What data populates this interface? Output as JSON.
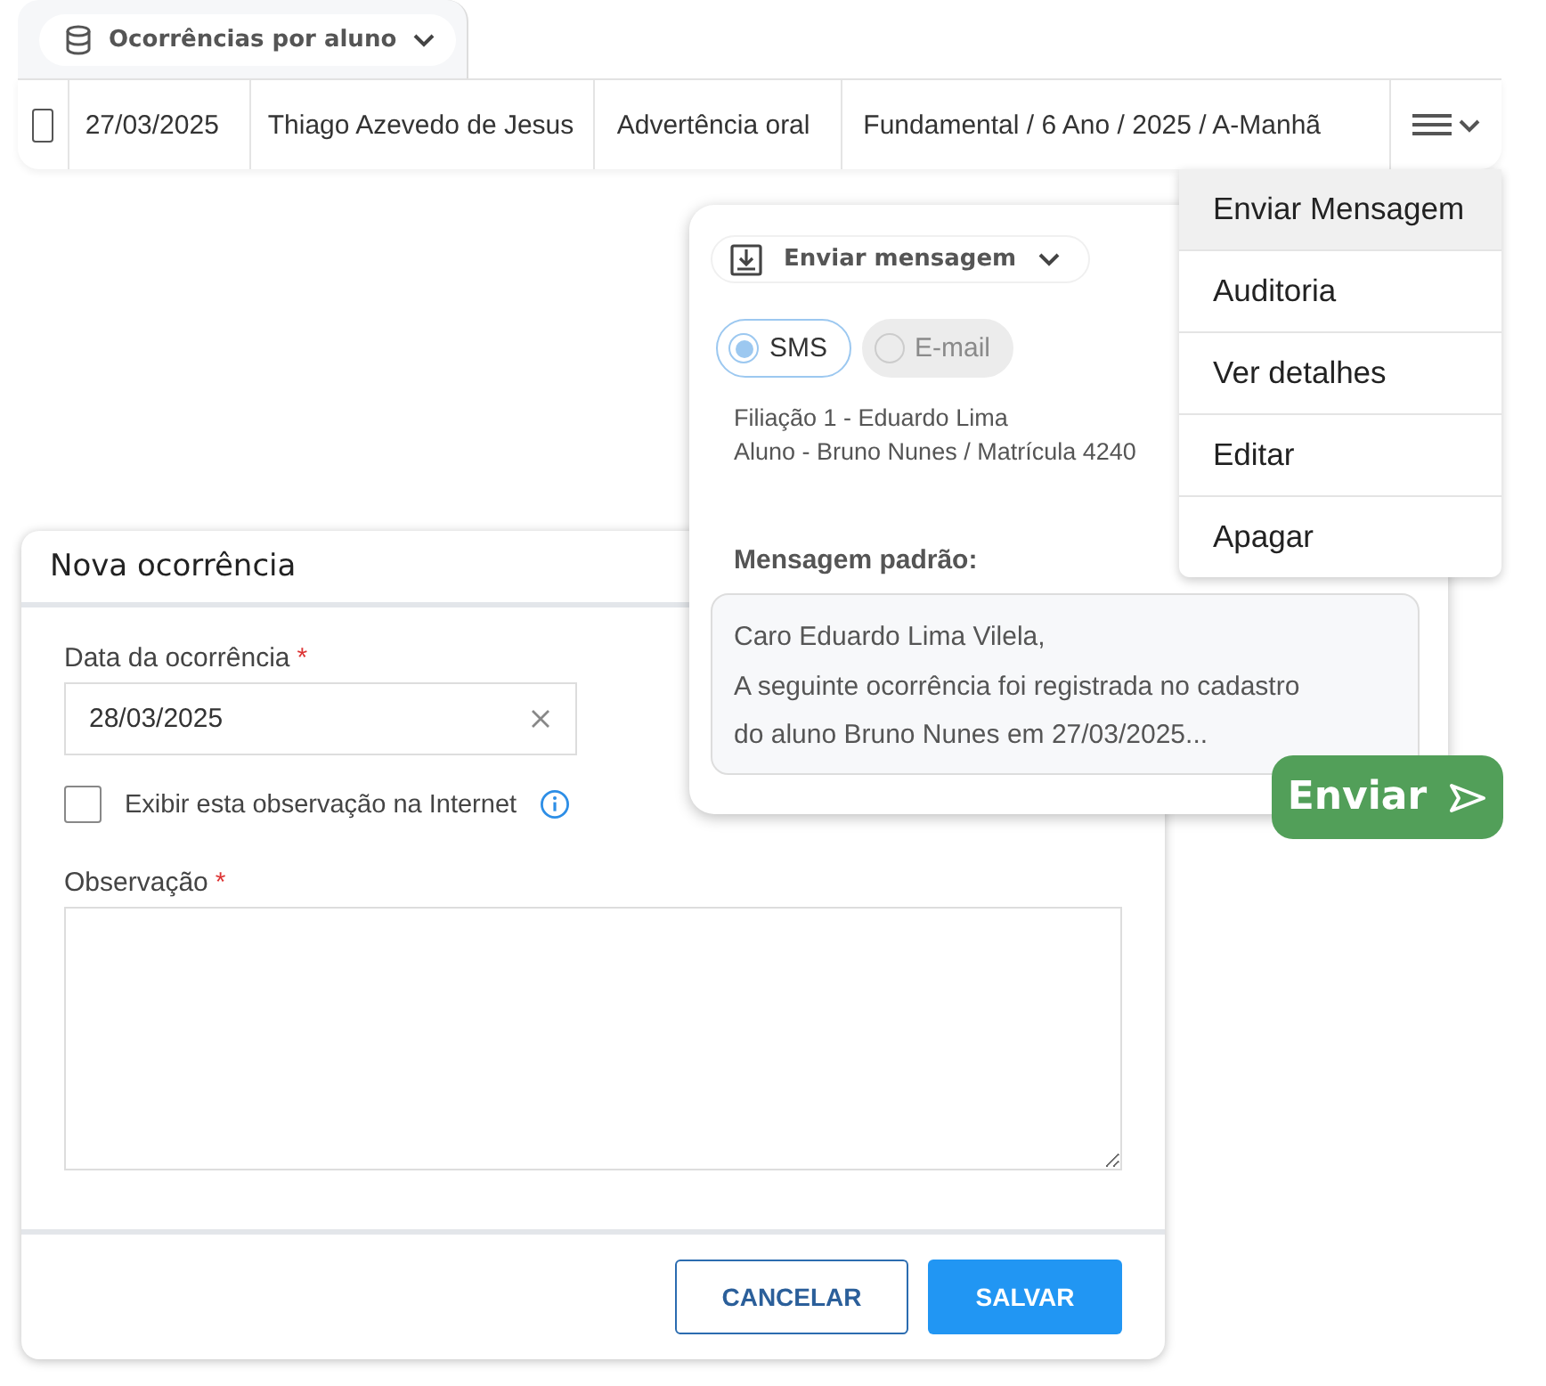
{
  "tab": {
    "label": "Ocorrências por aluno"
  },
  "row": {
    "checked": false,
    "cells": [
      "27/03/2025",
      "Thiago Azevedo de Jesus",
      "Advertência oral",
      "Fundamental / 6 Ano / 2025 / A-Manhã"
    ]
  },
  "menu": {
    "items": [
      {
        "label": "Enviar Mensagem",
        "selected": true
      },
      {
        "label": "Auditoria",
        "selected": false
      },
      {
        "label": "Ver detalhes",
        "selected": false
      },
      {
        "label": "Editar",
        "selected": false
      },
      {
        "label": "Apagar",
        "selected": false
      }
    ]
  },
  "message_panel": {
    "title": "Enviar mensagem",
    "channels": [
      {
        "label": "SMS",
        "selected": true,
        "disabled": false
      },
      {
        "label": "E-mail",
        "selected": false,
        "disabled": true
      }
    ],
    "recipients": [
      "Filiação 1 - Eduardo Lima",
      "Aluno - Bruno Nunes / Matrícula 4240"
    ],
    "message_label": "Mensagem padrão:",
    "message": "Caro Eduardo Lima Vilela,\nA seguinte ocorrência foi registrada no cadastro\ndo aluno Bruno Nunes em 27/03/2025...",
    "send_button": "Enviar"
  },
  "form": {
    "title": "Nova ocorrência",
    "date": {
      "label": "Data da ocorrência",
      "required_mark": "*",
      "value": "28/03/2025"
    },
    "internet": {
      "label": "Exibir esta observação na Internet",
      "checked": false
    },
    "observation": {
      "label": "Observação",
      "required_mark": "*"
    },
    "cancel_button": "CANCELAR",
    "save_button": "SALVAR"
  }
}
